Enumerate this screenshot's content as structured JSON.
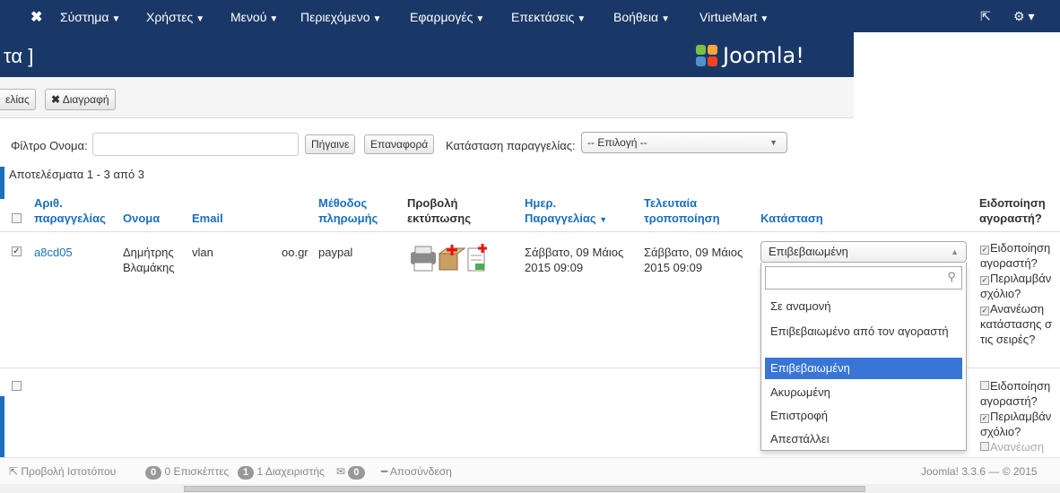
{
  "topnav": {
    "logo": "✖",
    "menus": [
      "Σύστημα",
      "Χρήστες",
      "Μενού",
      "Περιεχόμενο",
      "Εφαρμογές",
      "Επεκτάσεις",
      "Βοήθεια",
      "VirtueMart"
    ]
  },
  "header": {
    "title": "τα ]",
    "brand": "Joomla!"
  },
  "toolbar": {
    "btn1": "ελίας",
    "btn2": "Διαγραφή"
  },
  "filters": {
    "name_label": "Φίλτρο Ονομα:",
    "name_value": "",
    "go": "Πήγαινε",
    "reset": "Επαναφορά",
    "status_label": "Κατάσταση παραγγελίας:",
    "status_select": "-- Επιλογή --"
  },
  "results": "Αποτελέσματα 1 - 3 από 3",
  "table": {
    "headers": {
      "order_no": "Αριθ. παραγγελίας",
      "name": "Ονομα",
      "email": "Email",
      "payment": "Μέθοδος πληρωμής",
      "print": "Προβολή εκτύπωσης",
      "date": "Ημερ. Παραγγελίας",
      "modified": "Τελευταία τροποποίηση",
      "status": "Κατάσταση",
      "notify": "Ειδοποίηση αγοραστή?"
    },
    "row1": {
      "order_no": "a8cd05",
      "name": "Δημήτρης Βλαμάκης",
      "email_start": "vlan",
      "email_end": "oo.gr",
      "payment": "paypal",
      "date": "Σάββατο, 09 Μάιος 2015 09:09",
      "modified": "Σάββατο, 09 Μάιος 2015 09:09",
      "status": "Επιβεβαιωμένη"
    }
  },
  "dropdown": {
    "options": [
      "Σε αναμονή",
      "Επιβεβαιωμένο από τον αγοραστή",
      "Επιβεβαιωμένη",
      "Ακυρωμένη",
      "Επιστροφή",
      "Απεστάλλει"
    ],
    "selected": "Επιβεβαιωμένη"
  },
  "notify_block1": [
    "Ειδοποίηση",
    "αγοραστή?",
    "Περιλαμβάν",
    "σχόλιο?",
    "Ανανέωση",
    "κατάστασης σ",
    "τις σειρές?"
  ],
  "notify_block2": [
    "Ειδοποίηση",
    "αγοραστή?",
    "Περιλαμβάν",
    "σχόλιο?",
    "Ανανέωση"
  ],
  "statusbar": {
    "view_site": "Προβολή Ιστοτόπου",
    "visitors_count": "0",
    "visitors": "0 Επισκέπτες",
    "admins_count": "1",
    "admins": "1 Διαχειριστής",
    "messages_count": "0",
    "logout": "Αποσύνδεση",
    "version": "Joomla! 3.3.6 — © 2015"
  }
}
